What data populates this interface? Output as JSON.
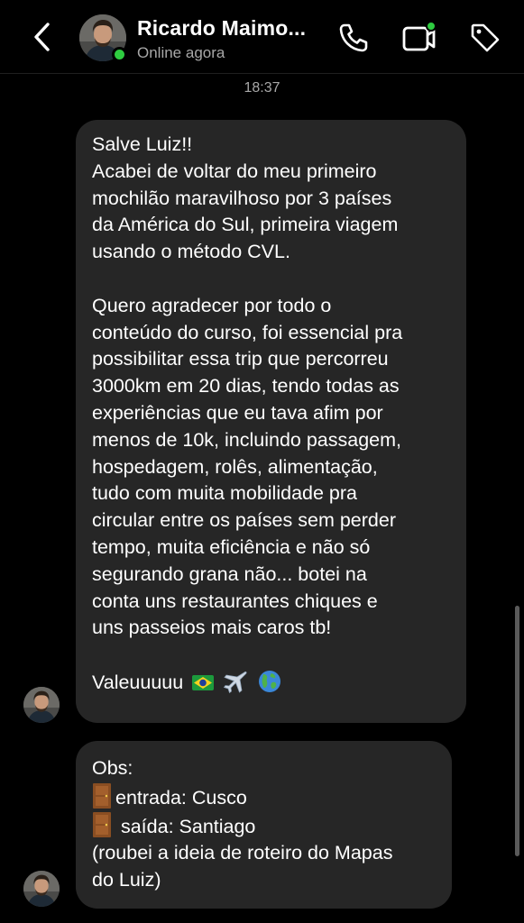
{
  "header": {
    "contact_name": "Ricardo Maimo...",
    "status": "Online agora",
    "icons": [
      "back-chevron-icon",
      "phone-icon",
      "video-call-icon",
      "tag-icon"
    ],
    "online_color": "#2ecc40"
  },
  "conversation": {
    "timestamp": "18:37",
    "messages": [
      {
        "lines": [
          "Salve Luiz!!",
          "Acabei de voltar do meu primeiro",
          "mochilão maravilhoso por 3 países",
          "da América do Sul, primeira viagem",
          "usando o método CVL.",
          "",
          "Quero agradecer por todo o",
          "conteúdo do curso, foi essencial pra",
          "possibilitar essa trip que percorreu",
          "3000km em 20 dias, tendo todas as",
          "experiências que eu tava afim por",
          "menos de 10k, incluindo passagem,",
          "hospedagem,  rolês, alimentação,",
          "tudo com muita mobilidade pra",
          "circular entre os países sem perder",
          "tempo, muita eficiência e não só",
          "segurando grana não... botei na",
          "conta uns restaurantes chiques e",
          "uns passeios mais caros tb!",
          "",
          "Valeuuuuu"
        ],
        "emojis": [
          "brazil-flag-emoji",
          "airplane-emoji",
          "globe-emoji"
        ]
      },
      {
        "lines": [
          "Obs:",
          "entrada: Cusco",
          " saída: Santiago",
          "(roubei a ideia de roteiro do Mapas",
          "do Luiz)"
        ],
        "emojis": [
          "door-emoji",
          "door-emoji"
        ]
      }
    ]
  },
  "colors": {
    "background": "#000000",
    "bubble": "#262626",
    "secondary_text": "#a8a8a8"
  }
}
